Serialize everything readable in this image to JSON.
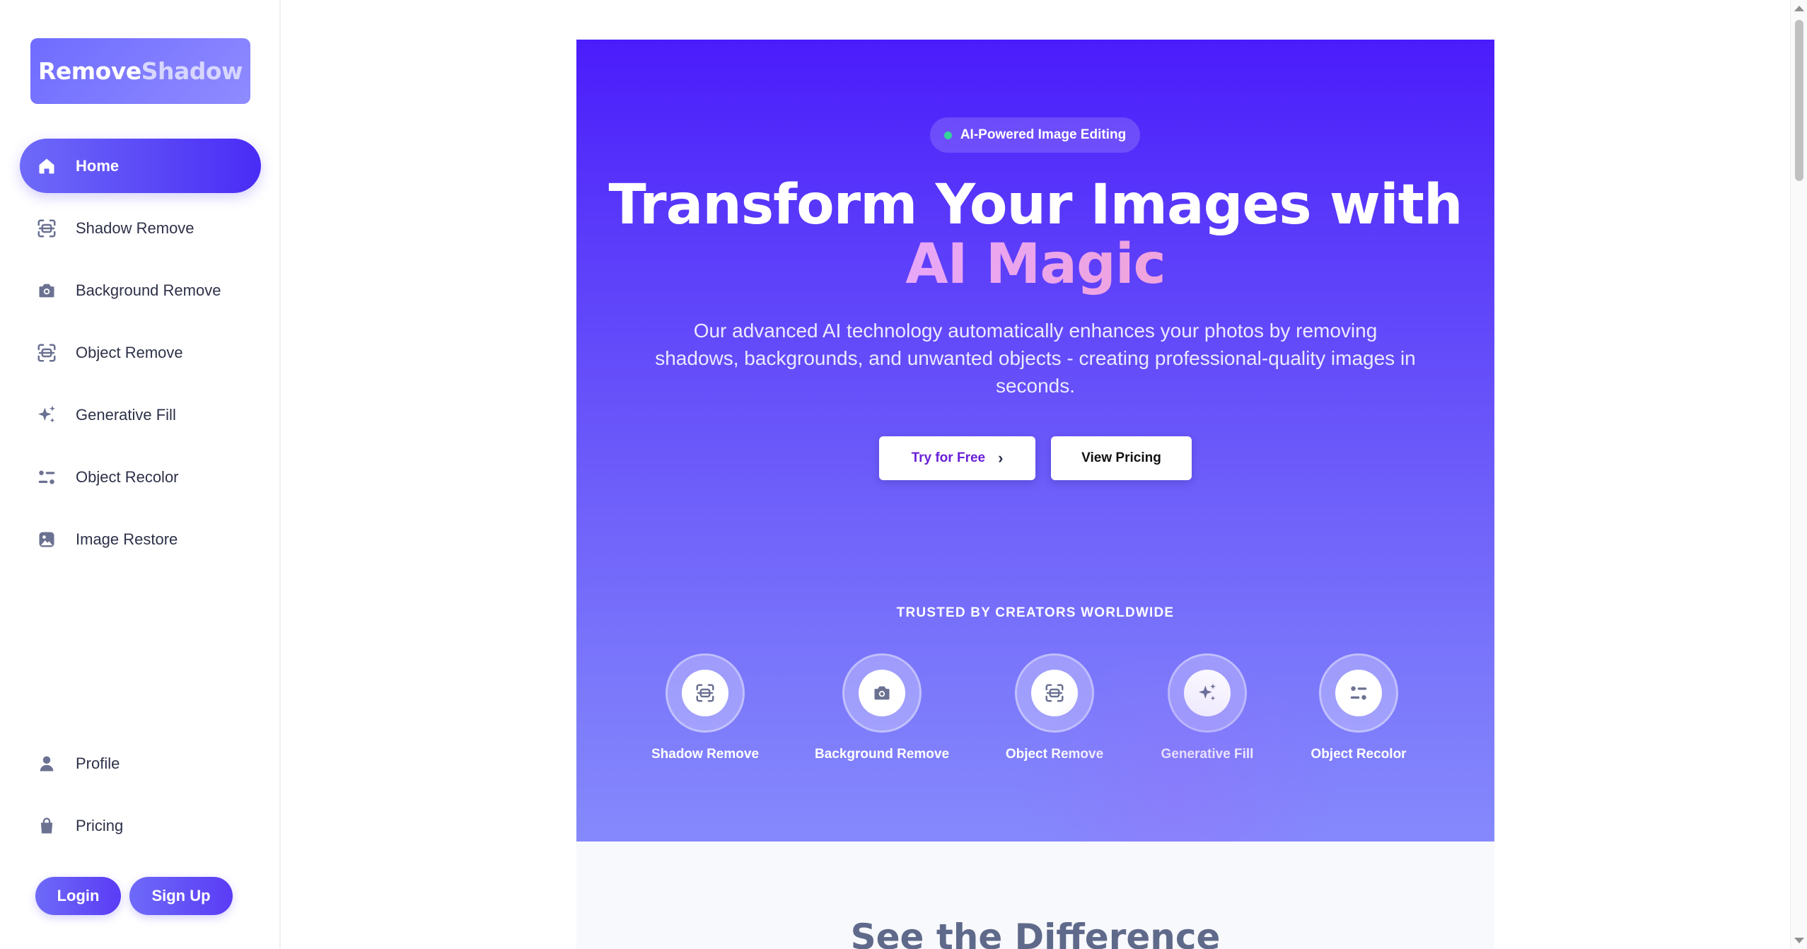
{
  "brand": {
    "part1": "Remove",
    "part2": "Shadow"
  },
  "sidebar": {
    "items": [
      {
        "label": "Home",
        "icon": "home-icon",
        "active": true
      },
      {
        "label": "Shadow Remove",
        "icon": "scan-face-icon"
      },
      {
        "label": "Background Remove",
        "icon": "camera-icon"
      },
      {
        "label": "Object Remove",
        "icon": "scan-face-icon"
      },
      {
        "label": "Generative Fill",
        "icon": "sparkles-icon"
      },
      {
        "label": "Object Recolor",
        "icon": "sliders-icon"
      },
      {
        "label": "Image Restore",
        "icon": "image-icon"
      }
    ],
    "bottom_items": [
      {
        "label": "Profile",
        "icon": "user-icon"
      },
      {
        "label": "Pricing",
        "icon": "shopping-bag-icon"
      }
    ],
    "login_label": "Login",
    "signup_label": "Sign Up"
  },
  "hero": {
    "badge": "AI-Powered Image Editing",
    "headline_main": "Transform Your Images with ",
    "headline_accent": "AI Magic",
    "subtitle": "Our advanced AI technology automatically enhances your photos by removing shadows, backgrounds, and unwanted objects - creating professional-quality images in seconds.",
    "try_label": "Try for Free",
    "pricing_label": "View Pricing",
    "trusted_label": "TRUSTED BY CREATORS WORLDWIDE",
    "tools": [
      {
        "label": "Shadow Remove",
        "icon": "scan-face-icon"
      },
      {
        "label": "Background Remove",
        "icon": "camera-icon"
      },
      {
        "label": "Object Remove",
        "icon": "scan-face-icon"
      },
      {
        "label": "Generative Fill",
        "icon": "sparkles-icon"
      },
      {
        "label": "Object Recolor",
        "icon": "sliders-icon"
      }
    ]
  },
  "section2": {
    "title": "See the Difference"
  },
  "colors": {
    "accent": "#5b3cf5",
    "hero_top": "#4a1cfb",
    "hero_bottom": "#8589fc",
    "icon_gray": "#6b7191",
    "status_dot": "#34d399"
  }
}
